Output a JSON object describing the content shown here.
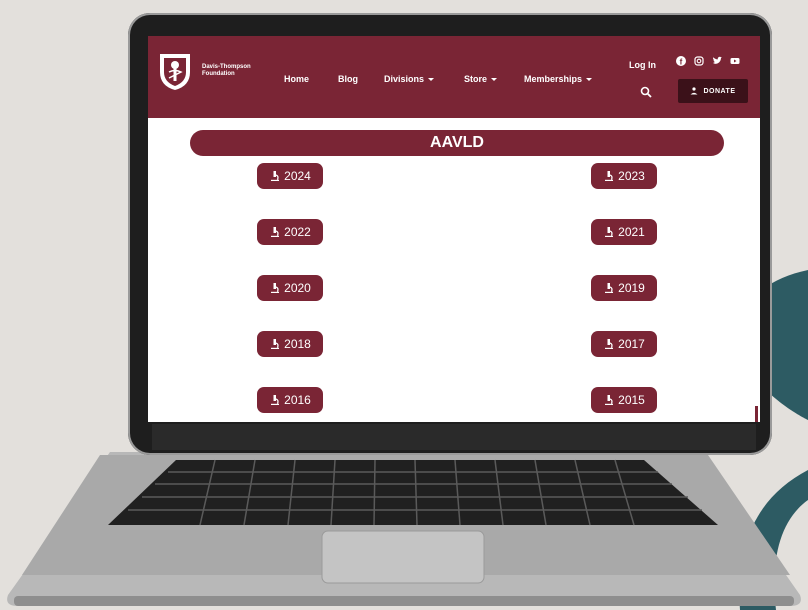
{
  "header": {
    "brand_line1": "Davis-Thompson",
    "brand_line2": "Foundation",
    "nav": [
      {
        "label": "Home"
      },
      {
        "label": "Blog"
      },
      {
        "label": "Divisions"
      },
      {
        "label": "Store"
      },
      {
        "label": "Memberships"
      }
    ],
    "login": "Log In",
    "donate": "DONATE",
    "social_icons": [
      "facebook-icon",
      "instagram-icon",
      "twitter-icon",
      "youtube-icon"
    ]
  },
  "main": {
    "banner": "AAVLD",
    "years": [
      {
        "label": "2024"
      },
      {
        "label": "2023"
      },
      {
        "label": "2022"
      },
      {
        "label": "2021"
      },
      {
        "label": "2020"
      },
      {
        "label": "2019"
      },
      {
        "label": "2018"
      },
      {
        "label": "2017"
      },
      {
        "label": "2016"
      },
      {
        "label": "2015"
      }
    ]
  },
  "colors": {
    "brand": "#7a2535",
    "donate_bg": "#3b1119",
    "background": "#e3e0dc",
    "accent_swoosh": "#2d5b63"
  }
}
